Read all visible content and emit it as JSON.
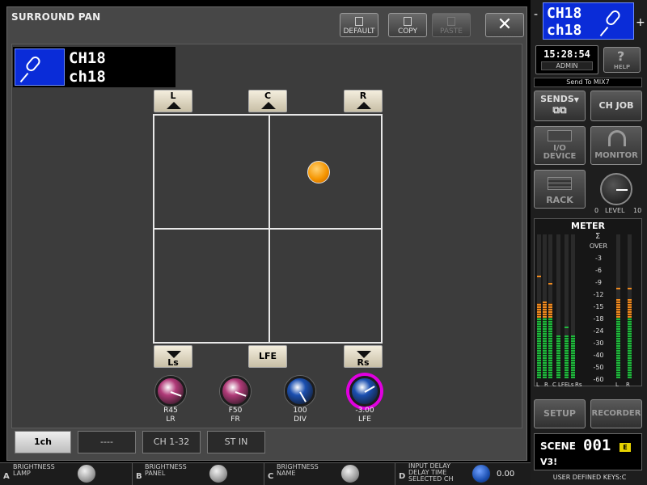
{
  "window": {
    "title": "SURROUND PAN",
    "buttons": {
      "default": "DEFAULT",
      "copy": "COPY",
      "paste": "PASTE",
      "close": "✕"
    }
  },
  "channel": {
    "number": "CH18",
    "name": "ch18"
  },
  "speakers": {
    "l": "L",
    "c": "C",
    "r": "R",
    "ls": "Ls",
    "lfe": "LFE",
    "rs": "Rs"
  },
  "pan_position": {
    "lr": 0.45,
    "fr": 0.5
  },
  "knobs": [
    {
      "value": "R45",
      "label": "LR",
      "color": "#b03a78"
    },
    {
      "value": "F50",
      "label": "FR",
      "color": "#b03a78"
    },
    {
      "value": "100",
      "label": "DIV",
      "color": "#1b4fb0"
    },
    {
      "value": "-3.00",
      "label": "LFE",
      "color": "#1b4fb0",
      "ring": "#e000e0"
    }
  ],
  "tabs": [
    "1ch",
    "----",
    "CH 1-32",
    "ST IN"
  ],
  "footer": [
    {
      "letter": "A",
      "lines": [
        "BRIGHTNESS",
        "LAMP"
      ]
    },
    {
      "letter": "B",
      "lines": [
        "BRIGHTNESS",
        "PANEL"
      ]
    },
    {
      "letter": "C",
      "lines": [
        "BRIGHTNESS",
        "NAME"
      ]
    },
    {
      "letter": "D",
      "lines": [
        "INPUT DELAY",
        "DELAY TIME",
        "SELECTED CH"
      ],
      "value": "0.00"
    }
  ],
  "right_panel": {
    "channel": {
      "number": "CH18",
      "name": "ch18",
      "minus": "-",
      "plus": "+"
    },
    "clock": "15:28:54",
    "user": "ADMIN",
    "help": "HELP",
    "send_to": "Send To MIX7",
    "sends": "SENDS",
    "ch_job": "CH JOB",
    "io_device": [
      "I/O",
      "DEVICE"
    ],
    "monitor": "MONITOR",
    "rack": "RACK",
    "level_label": "LEVEL",
    "level_min": "0",
    "level_max": "10",
    "meter_title": "METER",
    "meter_sigma": "Σ",
    "meter_scale": [
      "OVER",
      "-3",
      "-6",
      "-9",
      "-12",
      "-15",
      "-18",
      "-24",
      "-30",
      "-40",
      "-50",
      "-60"
    ],
    "meter_labels_left": [
      "L",
      "R",
      "C",
      "LFE",
      "Ls",
      "Rs"
    ],
    "meter_labels_right": [
      "L",
      "R"
    ],
    "setup": "SETUP",
    "recorder": "RECORDER",
    "scene_label": "SCENE",
    "scene_number": "001",
    "scene_badge": "E",
    "scene_name": "V3!",
    "user_keys": "USER DEFINED KEYS:C"
  }
}
